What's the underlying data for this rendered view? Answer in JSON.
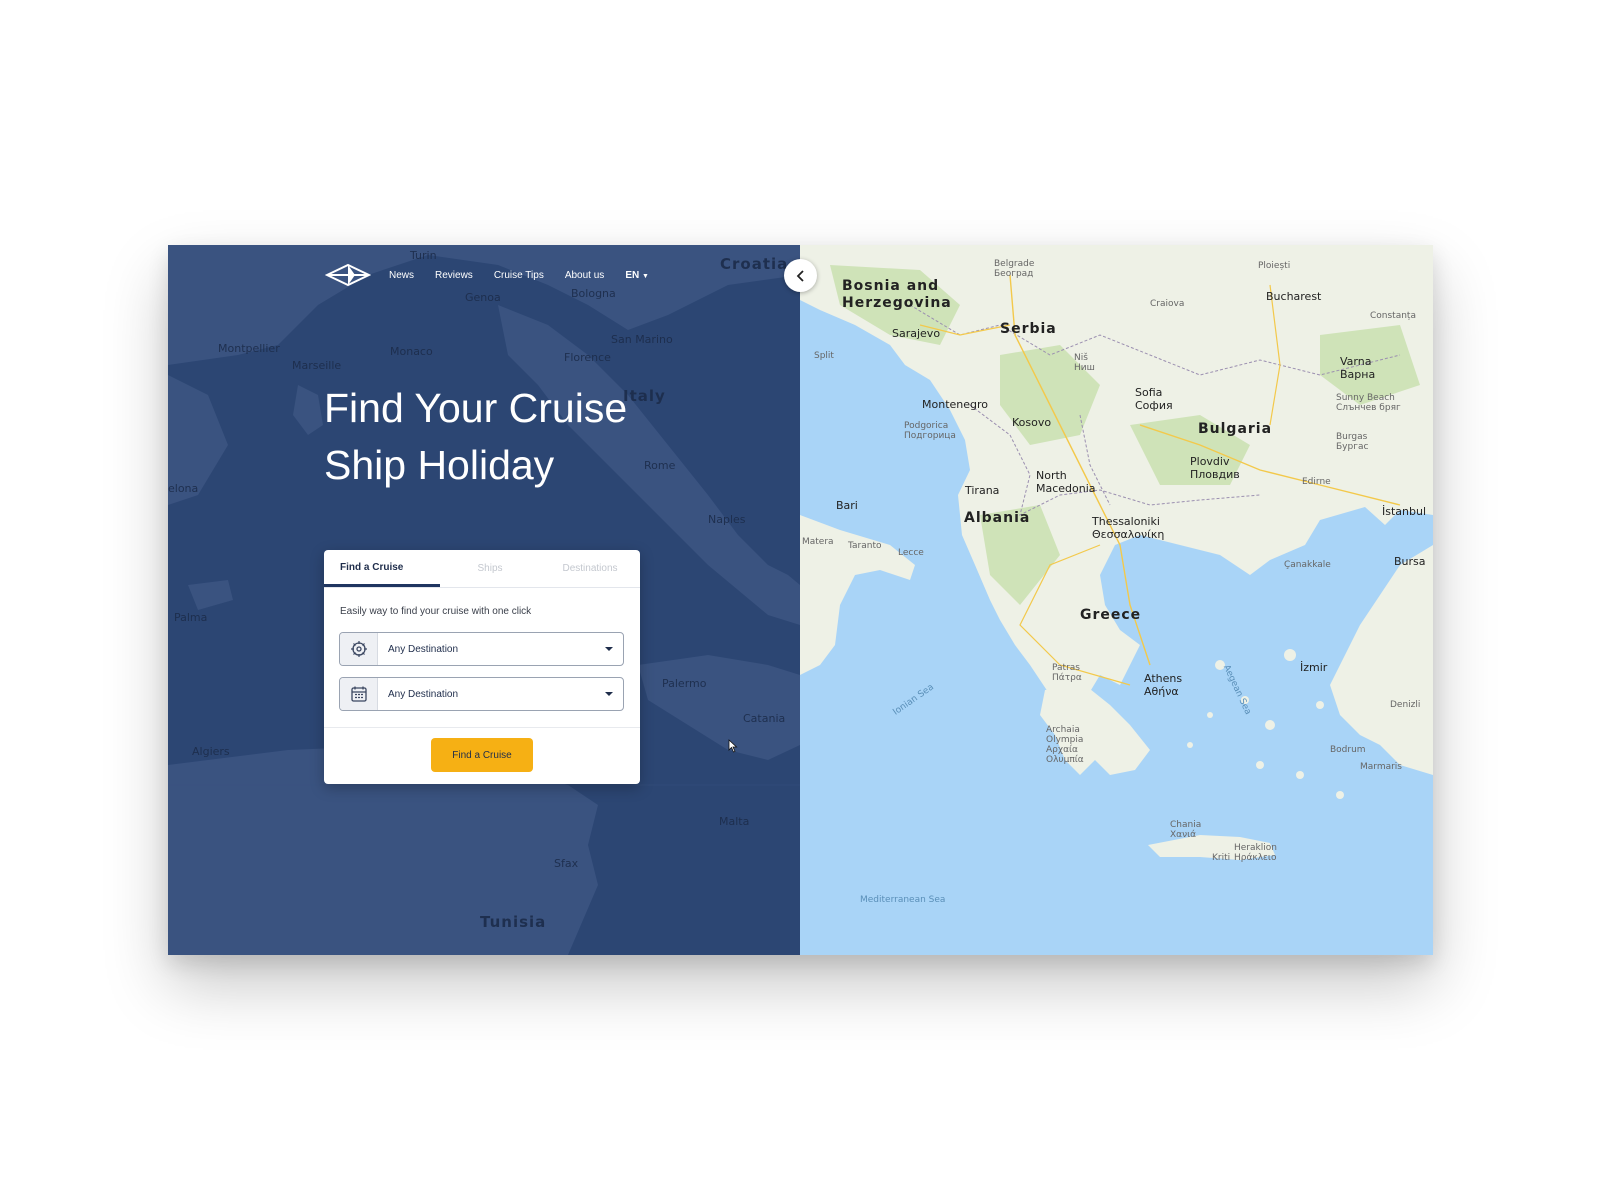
{
  "nav": {
    "links": [
      "News",
      "Reviews",
      "Cruise Tips",
      "About us"
    ],
    "language": "EN"
  },
  "hero": {
    "line1": "Find Your Cruise",
    "line2": "Ship Holiday"
  },
  "search_card": {
    "tabs": [
      "Find a Cruise",
      "Ships",
      "Destinations"
    ],
    "subtitle": "Easily way to find your cruise with one click",
    "destination_select": "Any Destination",
    "date_select": "Any Destination",
    "button_label": "Find a Cruise"
  },
  "left_map_labels": {
    "croatia": "Croatia",
    "turin": "Turin",
    "genoa": "Genoa",
    "bologna": "Bologna",
    "montpellier": "Montpellier",
    "monaco": "Monaco",
    "marseille": "Marseille",
    "san_marino": "San Marino",
    "florence": "Florence",
    "italy": "Italy",
    "rome": "Rome",
    "naples": "Naples",
    "palma": "Palma",
    "palermo": "Palermo",
    "catania": "Catania",
    "algiers": "Algiers",
    "malta": "Malta",
    "sfax": "Sfax",
    "tunisia": "Tunisia",
    "elona": "elona"
  },
  "right_map_labels": {
    "bosnia": "Bosnia and Herzegovina",
    "serbia": "Serbia",
    "sarajevo": "Sarajevo",
    "belgrade": "Belgrade Београд",
    "ploiesti": "Ploiești",
    "bucharest": "Bucharest",
    "craiova": "Craiova",
    "constanta": "Constanța",
    "varna": "Varna Варна",
    "split": "Split",
    "nis": "Niš Ниш",
    "sofia": "Sofia София",
    "montenegro": "Montenegro",
    "podgorica": "Podgorica Подгорица",
    "kosovo": "Kosovo",
    "bulgaria": "Bulgaria",
    "sunny_beach": "Sunny Beach Слънчев бряг",
    "burgas": "Burgas Бургас",
    "plovdiv": "Plovdiv Пловдив",
    "edirne": "Edirne",
    "tirana": "Tirana",
    "north_macedonia": "North Macedonia",
    "bari": "Bari",
    "albania": "Albania",
    "thessaloniki": "Thessaloniki Θεσσαλονίκη",
    "istanbul": "İstanbul",
    "taranto": "Taranto",
    "lecce": "Lecce",
    "materas": "Matera",
    "canakkale": "Çanakkale",
    "bursa": "Bursa",
    "greece": "Greece",
    "patras": "Patras Πάτρα",
    "athens": "Athens Αθήνα",
    "izmir": "İzmir",
    "ionian_sea": "Ionian Sea",
    "aegean_sea": "Aegean Sea",
    "denizli": "Denizli",
    "bodrum": "Bodrum",
    "marmaris": "Marmaris",
    "archaia": "Archaia Olympia Αρχαία Ολυμπία",
    "chania": "Chania Χανιά",
    "heraklion": "Heraklion Ηράκλειο",
    "kriti": "Kriti",
    "mediterranean": "Mediterranean Sea"
  },
  "colors": {
    "left_overlay": "#2c4673",
    "sea": "#a9d4f7",
    "land": "#eef1e6",
    "button": "#f6b014",
    "nav_text": "#ffffff"
  },
  "icons": [
    "logo-icon",
    "compass-icon",
    "calendar-icon",
    "caret-down-icon",
    "chevron-left-icon",
    "cursor-icon"
  ]
}
